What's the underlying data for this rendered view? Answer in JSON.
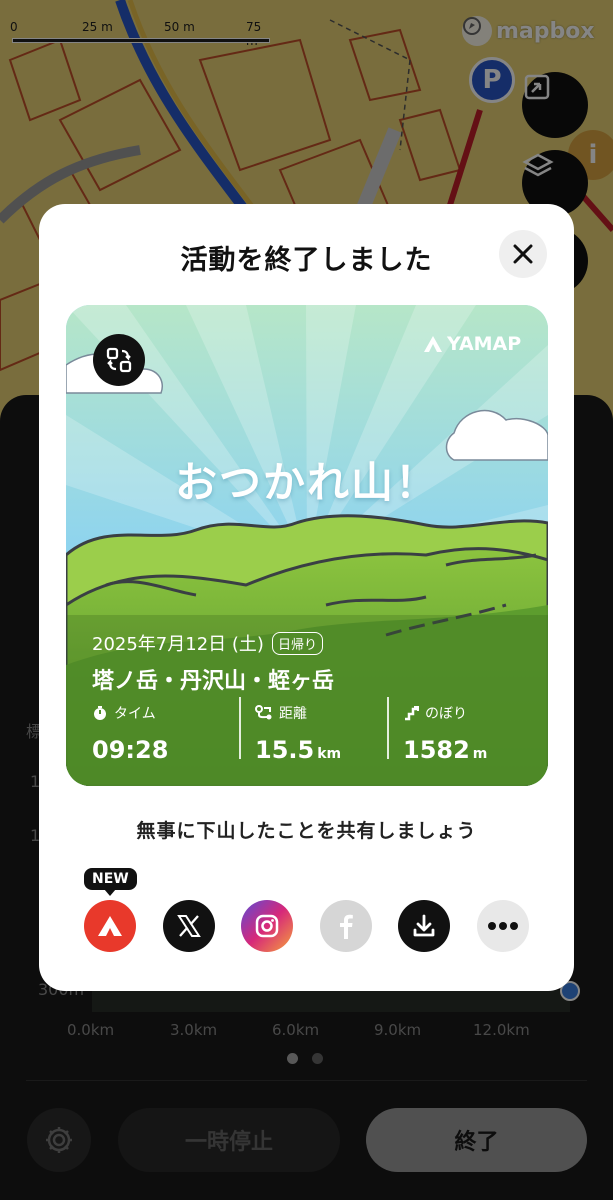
{
  "map": {
    "scale_labels": [
      "0",
      "25 m",
      "50 m",
      "75 m"
    ],
    "attribution": "mapbox",
    "parking_label": "P",
    "info_label": "i"
  },
  "panel": {
    "elevation_label_partial": "標",
    "y_ticks": [
      "1",
      "1",
      "300m"
    ],
    "x_ticks": [
      "0.0km",
      "3.0km",
      "6.0km",
      "9.0km",
      "12.0km"
    ],
    "pause_label": "一時停止",
    "finish_label": "終了"
  },
  "modal": {
    "title": "活動を終了しました",
    "card": {
      "brand": "YAMAP",
      "headline": "おつかれ山！",
      "date": "2025年7月12日 (土)",
      "trip_type": "日帰り",
      "mountains": "塔ノ岳・丹沢山・蛭ヶ岳",
      "stats": [
        {
          "label": "タイム",
          "value": "09:28",
          "unit": ""
        },
        {
          "label": "距離",
          "value": "15.5",
          "unit": "km"
        },
        {
          "label": "のぼり",
          "value": "1582",
          "unit": "m"
        }
      ]
    },
    "share_message": "無事に下山したことを共有しましょう",
    "new_badge": "NEW",
    "share_targets": [
      "yamap-icon",
      "x-icon",
      "instagram-icon",
      "facebook-icon",
      "download-icon",
      "more-icon"
    ],
    "colors": {
      "yamap_red": "#e8392b",
      "instagram_pink": "#d6287a",
      "facebook_gray": "#d6d6d6",
      "sky": "#8fd4ee",
      "grass": "#7fb83a"
    }
  }
}
